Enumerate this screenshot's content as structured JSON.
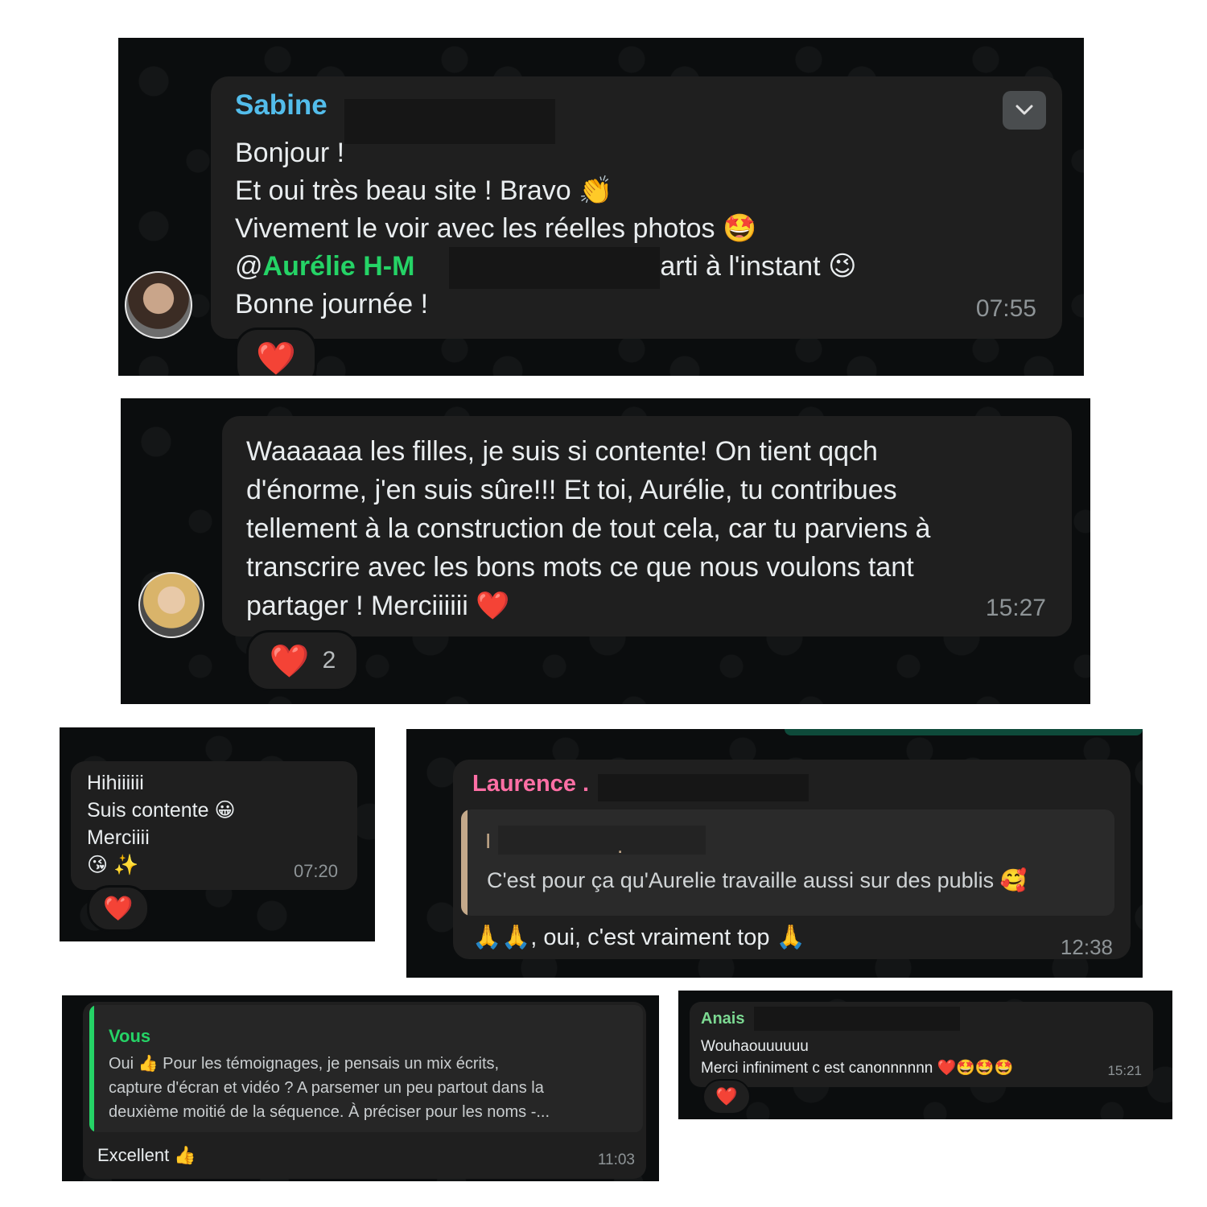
{
  "m1": {
    "sender": "Sabine",
    "line1": "Bonjour !",
    "line2_text": "Et oui très beau site ! Bravo",
    "line2_emoji": "👏",
    "line3_text": "Vivement le voir avec les réelles photos",
    "line3_emoji": "🤩",
    "mention_at": "@",
    "mention_name": "Aurélie H-M",
    "line4_rest": "parti à l'instant",
    "line4_emoji": "😉",
    "line5": "Bonne journée !",
    "time": "07:55",
    "reaction": "❤️",
    "menu_icon": "chevron-down-icon"
  },
  "m2": {
    "line1": "Waaaaaa les filles, je suis si contente! On tient qqch",
    "line2": "d'énorme, j'en suis sûre!!! Et toi, Aurélie, tu contribues",
    "line3": "tellement à la construction de tout cela, car tu parviens à",
    "line4": "transcrire avec les bons mots ce que nous voulons tant",
    "line5_text": "partager ! Merciiiiii",
    "line5_emoji": "❤️",
    "time": "15:27",
    "reaction": "❤️",
    "reaction_count": "2"
  },
  "m3": {
    "line1": "Hihiiiiii",
    "line2_text": "Suis contente",
    "line2_emoji": "😀",
    "line3": "Merciiii",
    "line4": "😘 ✨",
    "time": "07:20",
    "reaction": "❤️"
  },
  "m4": {
    "sender": "Laurence",
    "sender_suffix": ".",
    "quote_initial": "I",
    "quote_dot": ".",
    "quote_text": "C'est pour ça qu'Aurelie travaille aussi sur des publis",
    "quote_emoji": "🥰",
    "reply_prefix": "🙏🙏",
    "reply_text": ", oui, c'est vraiment top",
    "reply_emoji": "🙏",
    "time": "12:38"
  },
  "m5": {
    "quote_sender": "Vous",
    "quote_line1": "Oui 👍 Pour les témoignages, je pensais un mix écrits,",
    "quote_line2": "capture d'écran et vidéo ? A parsemer un peu partout dans la",
    "quote_line3": "deuxième moitié de la séquence. À préciser pour les noms -...",
    "text": "Excellent 👍",
    "time": "11:03"
  },
  "m6": {
    "sender": "Anais",
    "line1": "Wouhaouuuuuu",
    "line2": "Merci infiniment c est canonnnnnn ❤️🤩🤩🤩",
    "time": "15:21",
    "reaction": "❤️"
  },
  "colors": {
    "panel_bg": "#0b0d0e",
    "bubble_bg": "#1f1f1f",
    "sabine_name": "#53bdeb",
    "mention_green": "#25d366",
    "laurence_name": "#ff6fa5",
    "vous_name": "#25d366",
    "anais_name": "#7cd992",
    "quote_bar_beige": "#c4a98a",
    "quote_bar_green": "#25d366",
    "heart": "#e8312f"
  }
}
